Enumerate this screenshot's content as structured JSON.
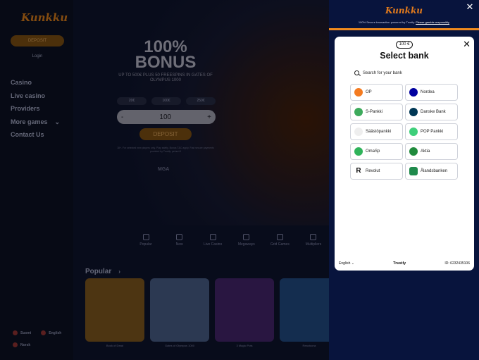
{
  "site": {
    "logo": "Kunkku",
    "deposit_label": "DEPOSIT",
    "login_label": "Login",
    "menu": [
      {
        "label": "Casino"
      },
      {
        "label": "Live casino"
      },
      {
        "label": "Providers"
      },
      {
        "label": "More games",
        "chevron": "⌄"
      },
      {
        "label": "Contact Us"
      }
    ],
    "footer": {
      "lang1": "Suomi",
      "lang2": "English",
      "lang3": "Norsk"
    },
    "hero": {
      "headline": "100% BONUS",
      "sub": "UP TO 500€ PLUS 50 FREESPINS IN GATES OF OLYMPUS 1000",
      "amounts": [
        "20€",
        "100€",
        "250€"
      ],
      "minus": "-",
      "value": "100",
      "plus": "+",
      "deposit_label": "DEPOSIT",
      "fine": "18+. For selected new players only. Play safely. Bonus T&C apply. Fast secure payments provided by Trustly. peluuri.fi",
      "mga": "MGA"
    },
    "categories": [
      "Popular",
      "New",
      "Live Casino",
      "Megaways",
      "Grid Games",
      "Multipliers"
    ],
    "popular_title": "Popular",
    "games": [
      {
        "name": "Book of Dead",
        "color": "#6b4a1a"
      },
      {
        "name": "Gates of Olympus 1000",
        "color": "#3e4f72"
      },
      {
        "name": "3 Magic Pots",
        "color": "#3a1f5a"
      },
      {
        "name": "Reactoonz",
        "color": "#1d3f6e"
      }
    ]
  },
  "trustly": {
    "brand": "Kunkku",
    "powered": "100% Secure transaction powered by Trustly.",
    "powered_link": "Please gamble responsibly",
    "close": "✕",
    "modal": {
      "amount": "100 €",
      "title": "Select bank",
      "close": "✕",
      "search_placeholder": "Search for your bank",
      "banks": [
        {
          "name": "OP",
          "color": "#f47b20"
        },
        {
          "name": "Nordea",
          "color": "#0000a0"
        },
        {
          "name": "S-Pankki",
          "color": "#3daa5c"
        },
        {
          "name": "Danske Bank",
          "color": "#003755"
        },
        {
          "name": "Säästöpankki",
          "color": "#eeeeee"
        },
        {
          "name": "POP Pankki",
          "color": "#3ecf7a"
        },
        {
          "name": "OmaSp",
          "color": "#2fb35a"
        },
        {
          "name": "Aktia",
          "color": "#1f8a3c"
        },
        {
          "name": "Revolut",
          "color": "#111111",
          "glyph": "R"
        },
        {
          "name": "Ålandsbanken",
          "color": "#1f8a4c"
        }
      ],
      "language": "English",
      "footer_brand": "Trustly",
      "id_text": "ID: 6232435106"
    }
  }
}
